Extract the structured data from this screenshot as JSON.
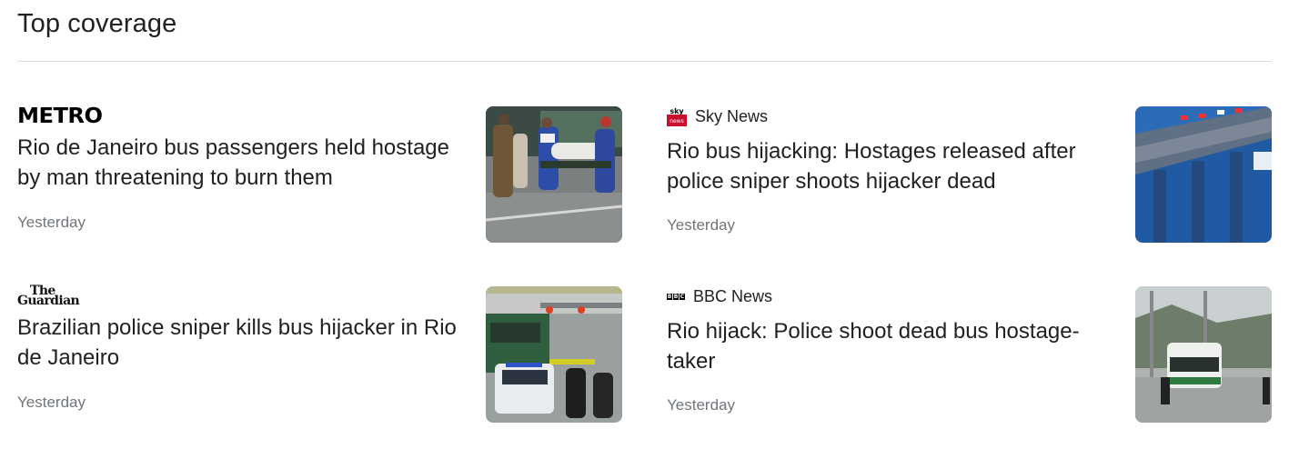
{
  "section": {
    "title": "Top coverage"
  },
  "articles": [
    {
      "source": "METRO",
      "source_icon": "metro-logo",
      "headline": "Rio de Janeiro bus passengers held hostage by man threatening to burn them",
      "time": "Yesterday",
      "thumbnail": "paramedics-stretcher-photo"
    },
    {
      "source": "Sky News",
      "source_icon": "sky-news-icon",
      "source_icon_text": "sky news",
      "headline": "Rio bus hijacking: Hostages released after police sniper shoots hijacker dead",
      "time": "Yesterday",
      "thumbnail": "bridge-aerial-photo"
    },
    {
      "source_line1": "The",
      "source_line2": "Guardian",
      "source_icon": "guardian-logo",
      "headline": "Brazilian police sniper kills bus hijacker in Rio de Janeiro",
      "time": "Yesterday",
      "thumbnail": "police-car-bus-photo"
    },
    {
      "source": "BBC News",
      "source_icon": "bbc-icon",
      "source_icon_letters": [
        "B",
        "B",
        "C"
      ],
      "headline": "Rio hijack: Police shoot dead bus hostage-taker",
      "time": "Yesterday",
      "thumbnail": "bus-on-bridge-photo"
    }
  ],
  "colors": {
    "text": "#202124",
    "secondary_text": "#70757a",
    "divider": "#dadce0",
    "sky_red": "#c8102e"
  }
}
